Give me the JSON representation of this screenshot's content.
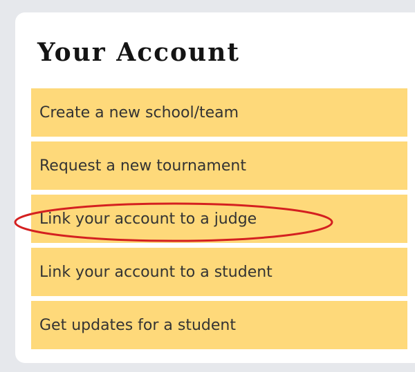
{
  "account_menu": {
    "title": "Your Account",
    "items": [
      {
        "label": "Create a new school/team"
      },
      {
        "label": "Request a new tournament"
      },
      {
        "label": "Link your account to a judge"
      },
      {
        "label": "Link your account to a student"
      },
      {
        "label": "Get updates for a student"
      }
    ]
  },
  "highlight": {
    "target": "Link your account to a judge",
    "color": "#d42020"
  }
}
